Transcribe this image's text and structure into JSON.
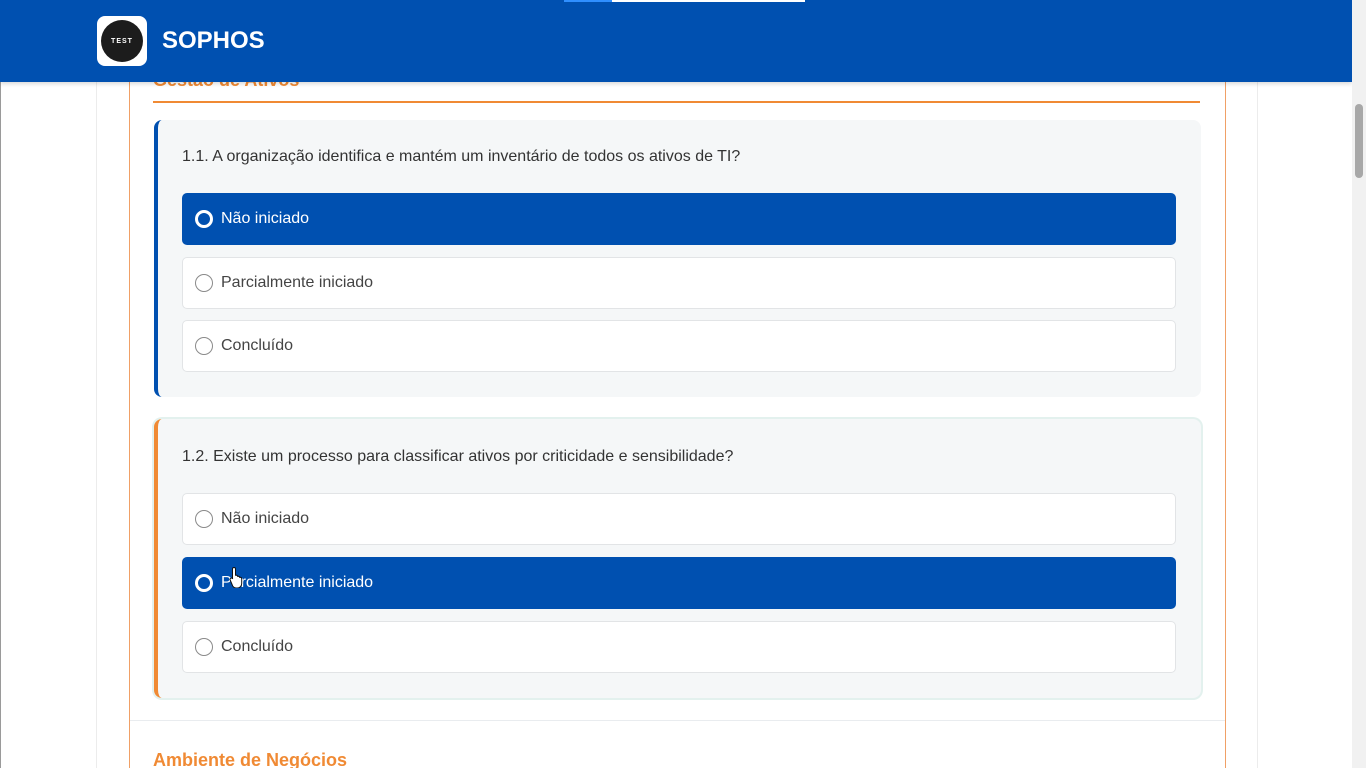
{
  "header": {
    "brand": "SOPHOS",
    "logo_text": "TEST",
    "color": "#0050b0"
  },
  "section": {
    "title": "Gestão de Ativos",
    "accent_color": "#f08a34"
  },
  "questions": [
    {
      "text": "1.1. A organização identifica e mantém um inventário de todos os ativos de TI?",
      "options": [
        {
          "label": "Não iniciado",
          "selected": true
        },
        {
          "label": "Parcialmente iniciado",
          "selected": false
        },
        {
          "label": "Concluído",
          "selected": false
        }
      ]
    },
    {
      "text": "1.2. Existe um processo para classificar ativos por criticidade e sensibilidade?",
      "options": [
        {
          "label": "Não iniciado",
          "selected": false
        },
        {
          "label": "Parcialmente iniciado",
          "selected": true
        },
        {
          "label": "Concluído",
          "selected": false
        }
      ]
    }
  ],
  "next_section": {
    "title": "Ambiente de Negócios"
  },
  "icons": {
    "cursor": "hand-pointer-icon",
    "radio": "radio-button-icon"
  }
}
